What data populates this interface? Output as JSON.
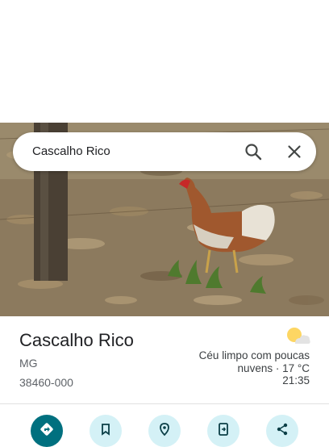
{
  "search": {
    "query": "Cascalho Rico"
  },
  "place": {
    "name": "Cascalho Rico",
    "state": "MG",
    "postal_code": "38460-000"
  },
  "weather": {
    "icon": "partly-sunny-icon",
    "line1": "Céu limpo com poucas",
    "line2": "nuvens · 17 °C",
    "time": "21:35"
  },
  "actions": [
    {
      "icon": "directions-icon"
    },
    {
      "icon": "bookmark-icon"
    },
    {
      "icon": "nearby-icon"
    },
    {
      "icon": "send-to-phone-icon"
    },
    {
      "icon": "share-icon"
    }
  ],
  "colors": {
    "accent": "#00707f",
    "action_bg": "#d4f1f6",
    "sun": "#fdd663"
  }
}
